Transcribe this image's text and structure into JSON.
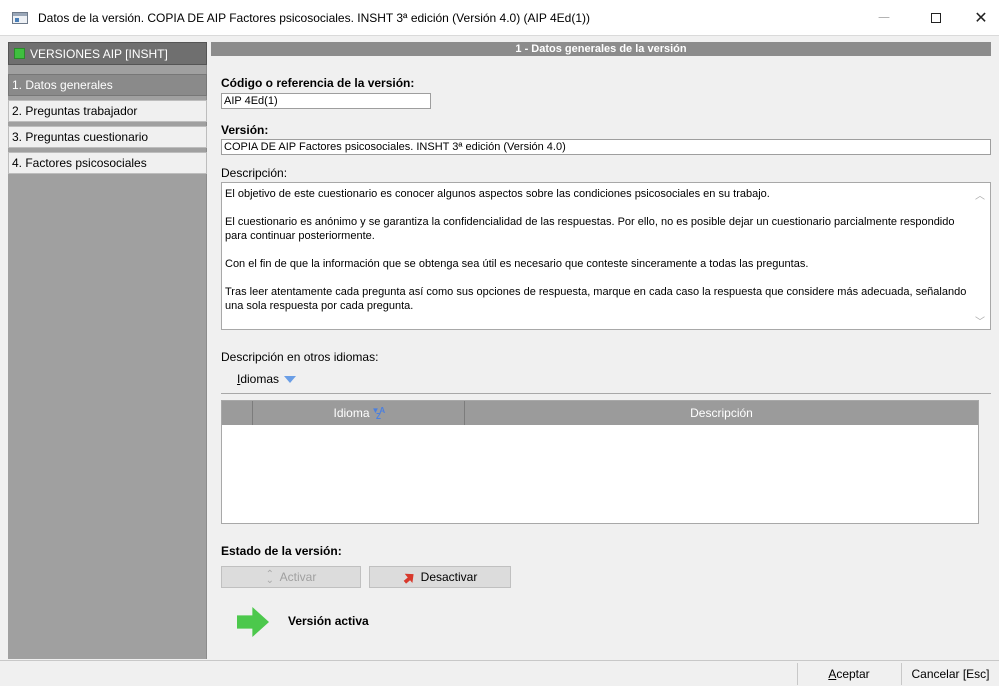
{
  "window": {
    "title": "Datos de la versión. COPIA DE AIP Factores psicosociales. INSHT 3ª edición (Versión 4.0) (AIP 4Ed(1))",
    "minimize_glyph": "—",
    "close_glyph": "✕"
  },
  "sidebar": {
    "header": "VERSIONES AIP [INSHT]",
    "items": [
      {
        "label": "1. Datos generales"
      },
      {
        "label": "2. Preguntas trabajador"
      },
      {
        "label": "3. Preguntas cuestionario"
      },
      {
        "label": "4. Factores psicosociales"
      }
    ]
  },
  "main": {
    "section_title": "1 - Datos generales de la versión",
    "code_label": "Código o referencia de la versión:",
    "code_value": "AIP 4Ed(1)",
    "version_label": "Versión:",
    "version_value": "COPIA DE AIP Factores psicosociales. INSHT 3ª edición (Versión 4.0)",
    "description_label": "Descripción:",
    "description_paragraphs": [
      "El objetivo de este cuestionario es conocer algunos aspectos sobre las condiciones psicosociales en su trabajo.",
      "El cuestionario es anónimo y se garantiza la confidencialidad de las respuestas. Por ello, no es posible dejar un cuestionario parcialmente respondido para continuar posteriormente.",
      "Con el fin de que la información que se obtenga sea útil es necesario que conteste sinceramente a todas las preguntas.",
      "Tras leer atentamente cada pregunta así como sus opciones de respuesta, marque en cada caso la respuesta que considere más adecuada, señalando una sola respuesta por cada pregunta."
    ],
    "other_languages_label": "Descripción en otros idiomas:",
    "idiomas_button_accel": "I",
    "idiomas_button_rest": "diomas",
    "grid": {
      "columns": [
        "Idioma",
        "Descripción"
      ],
      "rows": []
    },
    "state_label": "Estado de la versión:",
    "activar_label": "Activar",
    "desactivar_label": "Desactivar",
    "state_value": "Versión activa"
  },
  "footer": {
    "accept_accel": "A",
    "accept_rest": "ceptar",
    "cancel_label": "Cancelar [Esc]"
  },
  "colors": {
    "accent_active": "#3fbf3f",
    "header_gray": "#8c8c8c",
    "desactivar_icon": "#d8392c"
  }
}
